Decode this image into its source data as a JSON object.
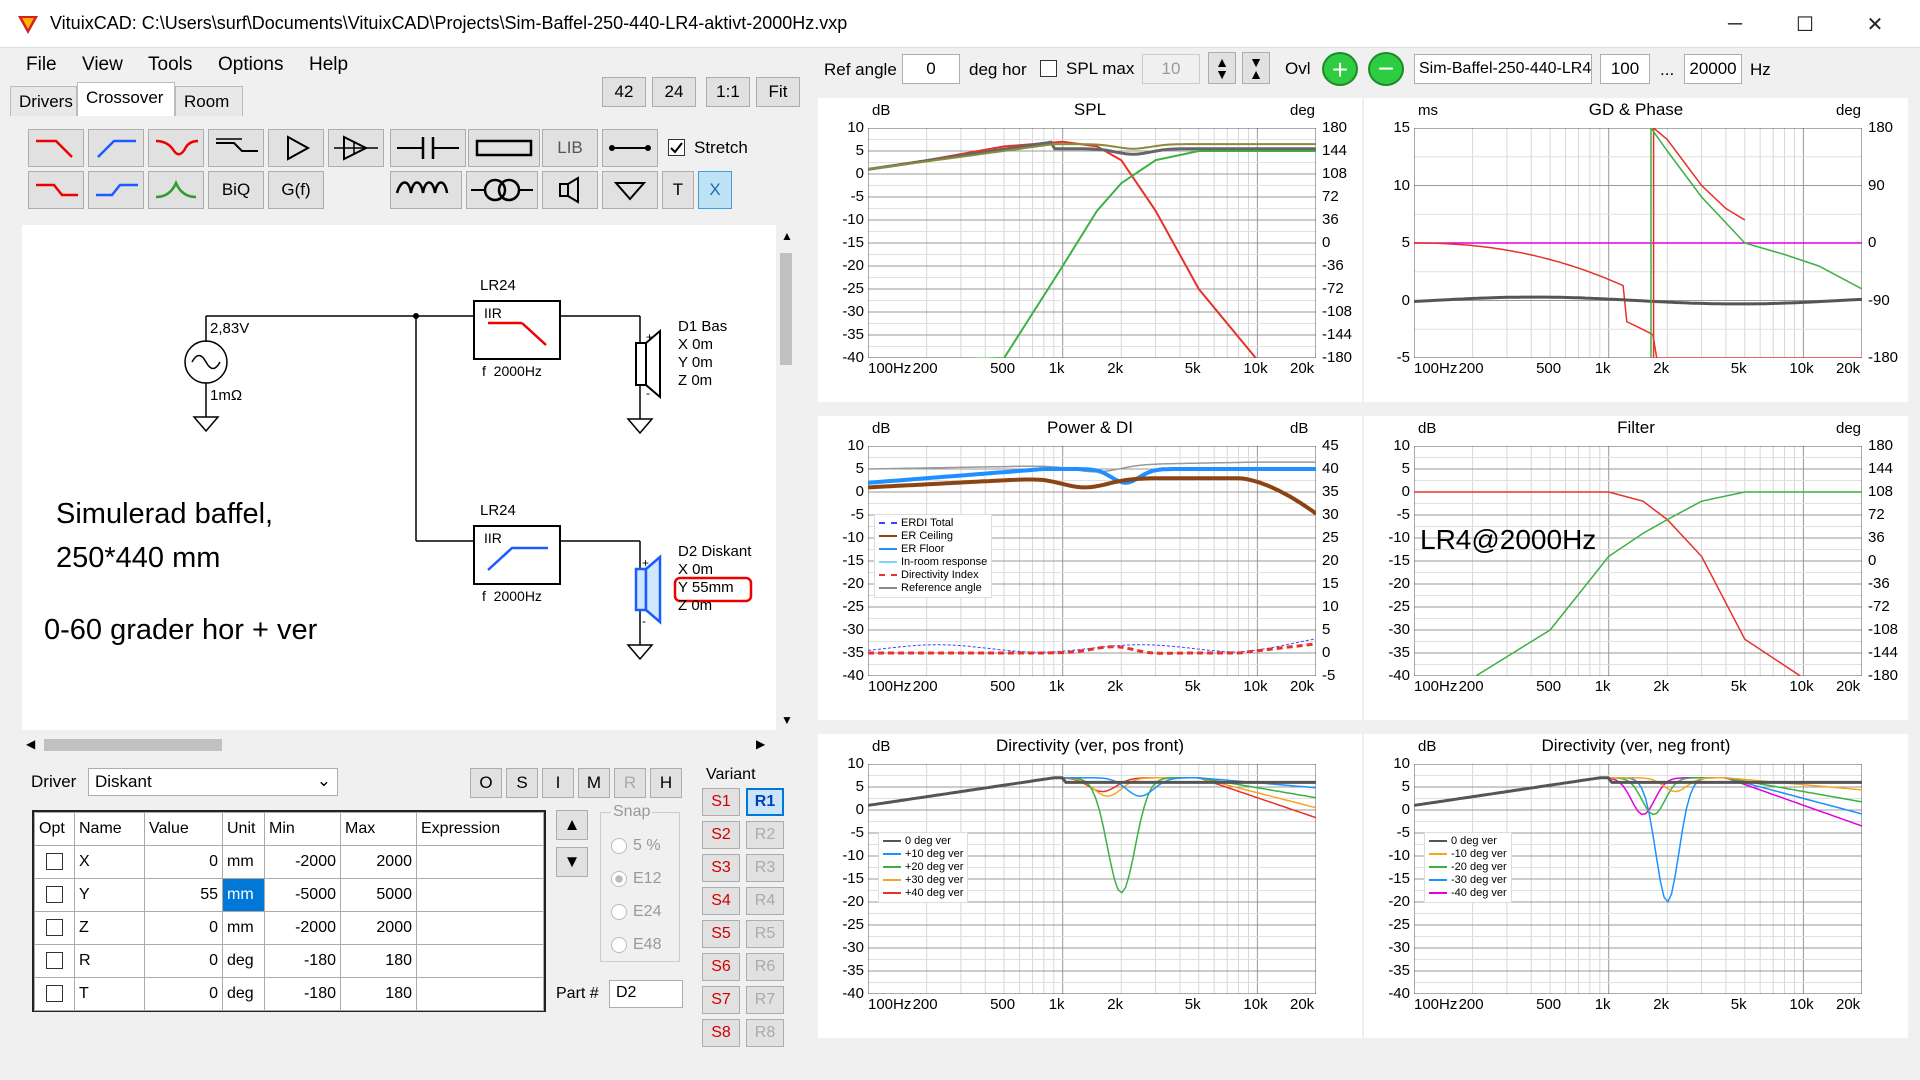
{
  "window": {
    "title": "VituixCAD: C:\\Users\\surf\\Documents\\VituixCAD\\Projects\\Sim-Baffel-250-440-LR4-aktivt-2000Hz.vxp",
    "minimize": "─",
    "maximize": "☐",
    "close": "✕"
  },
  "menu": [
    "File",
    "View",
    "Tools",
    "Options",
    "Help"
  ],
  "tabs": [
    "Drivers",
    "Crossover",
    "Room"
  ],
  "zoom": {
    "b1": "42",
    "b2": "24",
    "b3": "1:1",
    "b4": "Fit"
  },
  "toolbar": {
    "lib": "LIB",
    "biq": "BiQ",
    "gf": "G(f)",
    "t": "T",
    "x": "X",
    "stretch": "Stretch"
  },
  "schematic": {
    "source_v": "2,83V",
    "source_r": "1mΩ",
    "filter1": {
      "title": "LR24",
      "type": "IIR",
      "freq": "f  2000Hz"
    },
    "filter2": {
      "title": "LR24",
      "type": "IIR",
      "freq": "f  2000Hz"
    },
    "d1": {
      "name": "D1 Bas",
      "x": "X 0m",
      "y": "Y 0m",
      "z": "Z 0m"
    },
    "d2": {
      "name": "D2 Diskant",
      "x": "X 0m",
      "y": "Y 55mm",
      "z": "Z 0m"
    },
    "note1": "Simulerad baffel,",
    "note2": "250*440 mm",
    "note3": "0-60 grader hor + ver"
  },
  "driver": {
    "label": "Driver",
    "value": "Diskant",
    "buttons": [
      "O",
      "S",
      "I",
      "M",
      "R",
      "H"
    ]
  },
  "table": {
    "headers": [
      "Opt",
      "Name",
      "Value",
      "Unit",
      "Min",
      "Max",
      "Expression"
    ],
    "rows": [
      {
        "name": "X",
        "value": "0",
        "unit": "mm",
        "min": "-2000",
        "max": "2000"
      },
      {
        "name": "Y",
        "value": "55",
        "unit": "mm",
        "min": "-5000",
        "max": "5000"
      },
      {
        "name": "Z",
        "value": "0",
        "unit": "mm",
        "min": "-2000",
        "max": "2000"
      },
      {
        "name": "R",
        "value": "0",
        "unit": "deg",
        "min": "-180",
        "max": "180"
      },
      {
        "name": "T",
        "value": "0",
        "unit": "deg",
        "min": "-180",
        "max": "180"
      }
    ]
  },
  "snap": {
    "label": "Snap",
    "options": [
      "5 %",
      "E12",
      "E24",
      "E48"
    ]
  },
  "part": {
    "label": "Part #",
    "value": "D2"
  },
  "variant": {
    "label": "Variant",
    "s": [
      "S1",
      "S2",
      "S3",
      "S4",
      "S5",
      "S6",
      "S7",
      "S8"
    ],
    "r": [
      "R1",
      "R2",
      "R3",
      "R4",
      "R5",
      "R6",
      "R7",
      "R8"
    ]
  },
  "top": {
    "ref_angle_label": "Ref angle",
    "ref_angle": "0",
    "deg_hor": "deg hor",
    "spl_max": "SPL max",
    "spl_max_val": "10",
    "ovl": "Ovl",
    "project": "Sim-Baffel-250-440-LR4",
    "f_min": "100",
    "dots": "...",
    "f_max": "20000",
    "hz": "Hz"
  },
  "axes": {
    "x": [
      "100Hz",
      "200",
      "500",
      "1k",
      "2k",
      "5k",
      "10k",
      "20k"
    ],
    "y_db": [
      "10",
      "5",
      "0",
      "-5",
      "-10",
      "-15",
      "-20",
      "-25",
      "-30",
      "-35",
      "-40"
    ],
    "y_deg": [
      "180",
      "144",
      "108",
      "72",
      "36",
      "0",
      "-36",
      "-72",
      "-108",
      "-144",
      "-180"
    ],
    "y_gd": [
      "15",
      "10",
      "5",
      "0",
      "-5"
    ],
    "y_gd_deg": [
      "180",
      "90",
      "0",
      "-90",
      "-180"
    ],
    "y_di": [
      "45",
      "40",
      "35",
      "30",
      "25",
      "20",
      "15",
      "10",
      "5",
      "0",
      "-5"
    ]
  },
  "charts": {
    "spl": {
      "title": "SPL",
      "unit_l": "dB",
      "unit_r": "deg"
    },
    "gd": {
      "title": "GD & Phase",
      "unit_l": "ms",
      "unit_r": "deg"
    },
    "power": {
      "title": "Power & DI",
      "unit_l": "dB",
      "unit_r": "dB",
      "legend": [
        "ERDI Total",
        "ER Ceiling",
        "ER Floor",
        "In-room response",
        "Directivity Index",
        "Reference angle"
      ]
    },
    "filter": {
      "title": "Filter",
      "unit_l": "dB",
      "unit_r": "deg",
      "annotation": "LR4@2000Hz"
    },
    "dir_pos": {
      "title": "Directivity (ver, pos front)",
      "unit_l": "dB",
      "legend": [
        "0 deg ver",
        "+10 deg ver",
        "+20 deg ver",
        "+30 deg ver",
        "+40 deg ver"
      ]
    },
    "dir_neg": {
      "title": "Directivity (ver, neg front)",
      "unit_l": "dB",
      "legend": [
        "0 deg ver",
        "-10 deg ver",
        "-20 deg ver",
        "-30 deg ver",
        "-40 deg ver"
      ]
    }
  },
  "colors": {
    "red": "#e8312a",
    "green": "#3cb043",
    "olive": "#8a8a3a",
    "gray": "#666666",
    "blue": "#1e90ff",
    "brown": "#8b4513",
    "magenta": "#e000e0",
    "orange": "#f5a623",
    "yellow": "#d8d800"
  },
  "chart_data": [
    {
      "type": "line",
      "title": "SPL",
      "xlabel": "",
      "ylabel": "dB",
      "xscale": "log",
      "xlim": [
        100,
        20000
      ],
      "ylim": [
        -40,
        10
      ],
      "x": [
        100,
        200,
        500,
        1000,
        1500,
        2000,
        3000,
        5000,
        10000,
        20000
      ],
      "series": [
        {
          "values": [
            1,
            3,
            6,
            7,
            6,
            3,
            -8,
            -25,
            -60,
            -80
          ]
        },
        {
          "values": [
            -60,
            -60,
            -40,
            -20,
            -8,
            -2,
            3,
            5,
            5,
            5
          ]
        },
        {
          "values": [
            1,
            3,
            6,
            7,
            6,
            4,
            5,
            5,
            5,
            5
          ]
        }
      ]
    },
    {
      "type": "line",
      "title": "Filter",
      "xscale": "log",
      "xlim": [
        100,
        20000
      ],
      "ylim": [
        -40,
        10
      ],
      "x": [
        100,
        200,
        500,
        1000,
        1500,
        2000,
        3000,
        5000,
        10000,
        20000
      ],
      "series": [
        {
          "values": [
            0,
            0,
            0,
            0,
            -2,
            -6,
            -14,
            -32,
            -60,
            -80
          ]
        },
        {
          "values": [
            -80,
            -60,
            -30,
            -14,
            -9,
            -6,
            -2,
            0,
            0,
            0
          ]
        }
      ]
    }
  ]
}
